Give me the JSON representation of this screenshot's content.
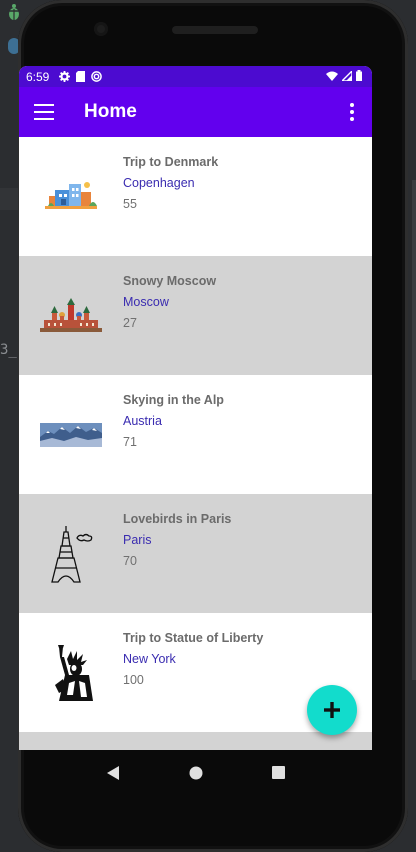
{
  "status_bar": {
    "time": "6:59",
    "left_icons": [
      "gear-icon",
      "sd-card-icon",
      "sync-icon"
    ],
    "right_icons": [
      "wifi-icon",
      "signal-icon",
      "battery-icon"
    ]
  },
  "app_bar": {
    "title": "Home",
    "background": "#6200ee",
    "status_color": "#4c0bd0"
  },
  "trips": [
    {
      "name": "Trip to Denmark",
      "place": "Copenhagen",
      "value": "55",
      "image": "copenhagen-illustration",
      "bg": "white"
    },
    {
      "name": "Snowy Moscow",
      "place": "Moscow",
      "value": "27",
      "image": "moscow-kremlin",
      "bg": "gray"
    },
    {
      "name": "Skying in the Alp",
      "place": "Austria",
      "value": "71",
      "image": "alps-mountains",
      "bg": "white"
    },
    {
      "name": "Lovebirds in Paris",
      "place": "Paris",
      "value": "70",
      "image": "eiffel-tower",
      "bg": "gray"
    },
    {
      "name": "Trip to Statue of Liberty",
      "place": "New York",
      "value": "100",
      "image": "statue-of-liberty",
      "bg": "white"
    }
  ],
  "fab": {
    "icon": "plus-icon",
    "color": "#12dccc"
  },
  "nav_bar": [
    "back-icon",
    "home-icon",
    "recents-icon"
  ],
  "colors": {
    "row_gray": "#d3d3d3",
    "place_text": "#3a2cb0",
    "title_text": "#6b6b6b"
  }
}
